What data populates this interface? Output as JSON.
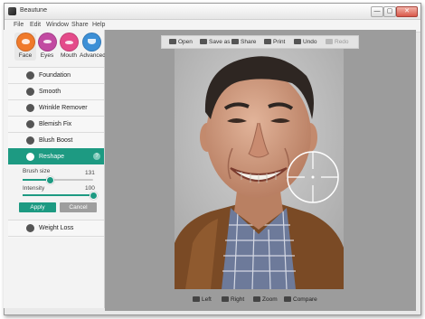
{
  "window": {
    "title": "Beautune",
    "controls": [
      "—",
      "▢",
      "✕"
    ]
  },
  "menu": [
    "File",
    "Edit",
    "Window",
    "Share",
    "Help"
  ],
  "categories": [
    {
      "label": "Face",
      "color": "#f07a2b",
      "icon": "face-icon",
      "active": true
    },
    {
      "label": "Eyes",
      "color": "#c24aa2",
      "icon": "eye-icon",
      "active": false
    },
    {
      "label": "Mouth",
      "color": "#e44b8a",
      "icon": "lips-icon",
      "active": false
    },
    {
      "label": "Advanced",
      "color": "#3c8fd6",
      "icon": "heart-icon",
      "active": false
    }
  ],
  "tools": [
    {
      "label": "Foundation",
      "icon": "foundation-icon"
    },
    {
      "label": "Smooth",
      "icon": "smooth-icon"
    },
    {
      "label": "Wrinkle Remover",
      "icon": "wrinkle-icon"
    },
    {
      "label": "Blemish Fix",
      "icon": "blemish-icon"
    },
    {
      "label": "Blush Boost",
      "icon": "blush-icon"
    },
    {
      "label": "Reshape",
      "icon": "reshape-icon",
      "active": true,
      "help": "?"
    },
    {
      "label": "Weight Loss",
      "icon": "weight-loss-icon"
    }
  ],
  "reshape_panel": {
    "brush_size_label": "Brush size",
    "brush_size_value": "131",
    "brush_size_level": 0.38,
    "intensity_label": "Intensity",
    "intensity_value": "100",
    "intensity_level": 1.0,
    "apply_label": "Apply",
    "cancel_label": "Cancel"
  },
  "toolbar": [
    {
      "label": "Open",
      "icon": "folder-icon",
      "enabled": true
    },
    {
      "label": "Save as",
      "icon": "save-icon",
      "enabled": true
    },
    {
      "label": "Share",
      "icon": "share-icon",
      "enabled": true
    },
    {
      "label": "Print",
      "icon": "print-icon",
      "enabled": true
    },
    {
      "label": "Undo",
      "icon": "undo-icon",
      "enabled": true
    },
    {
      "label": "Redo",
      "icon": "redo-icon",
      "enabled": false
    }
  ],
  "bottom_bar": [
    {
      "label": "Left",
      "icon": "rotate-left-icon"
    },
    {
      "label": "Right",
      "icon": "rotate-right-icon"
    },
    {
      "label": "Zoom",
      "icon": "zoom-icon"
    },
    {
      "label": "Compare",
      "icon": "compare-icon"
    }
  ],
  "colors": {
    "accent": "#1d9a82",
    "cancel": "#9e9e9e",
    "canvas": "#9c9c9c"
  }
}
